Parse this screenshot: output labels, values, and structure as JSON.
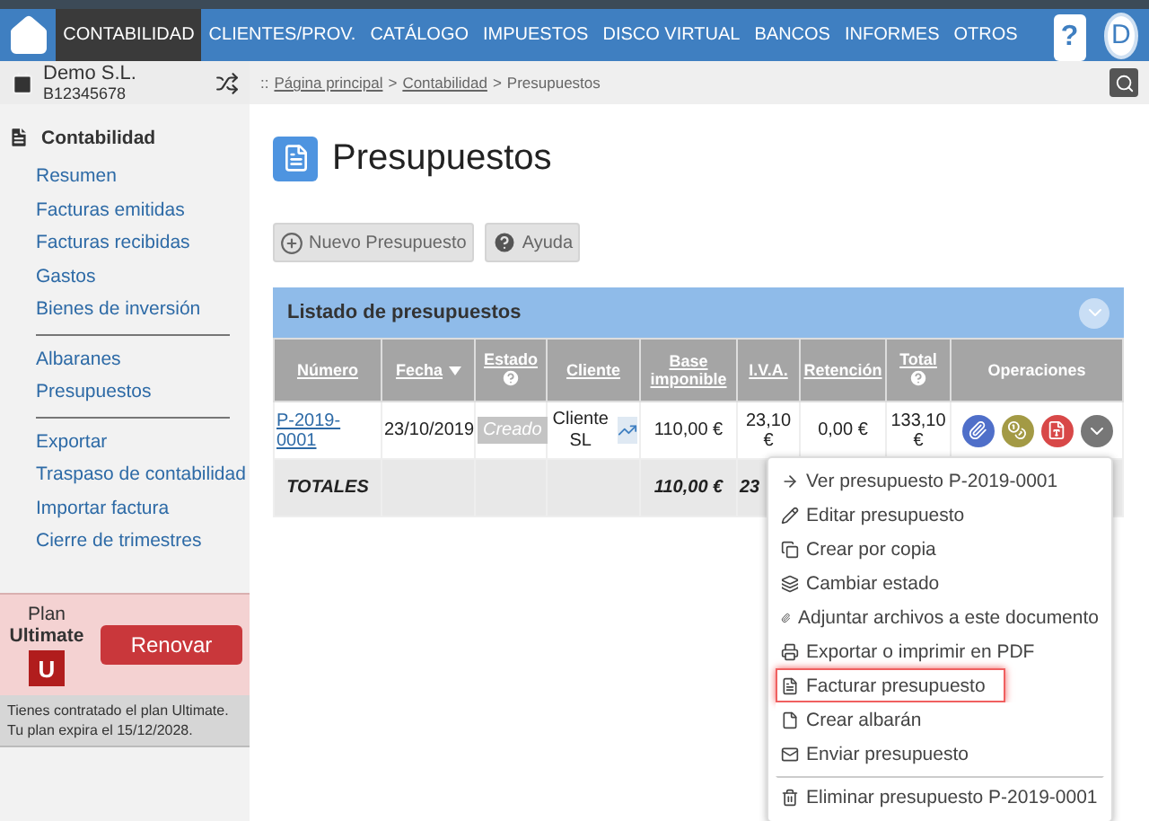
{
  "nav": {
    "items": [
      {
        "label": "CONTABILIDAD",
        "selected": true
      },
      {
        "label": "CLIENTES/PROV.",
        "selected": false
      },
      {
        "label": "CATÁLOGO",
        "selected": false
      },
      {
        "label": "IMPUESTOS",
        "selected": false
      },
      {
        "label": "DISCO VIRTUAL",
        "selected": false
      },
      {
        "label": "BANCOS",
        "selected": false
      },
      {
        "label": "INFORMES",
        "selected": false
      },
      {
        "label": "OTROS",
        "selected": false
      }
    ],
    "help": "?",
    "avatar": "D"
  },
  "company": {
    "name": "Demo S.L.",
    "cif": "B12345678"
  },
  "breadcrumb": {
    "prefix": "::",
    "separator": ">",
    "links": [
      "Página principal",
      "Contabilidad"
    ],
    "current": "Presupuestos"
  },
  "sidebar": {
    "section": "Contabilidad",
    "groups": [
      [
        "Resumen",
        "Facturas emitidas",
        "Facturas recibidas",
        "Gastos",
        "Bienes de inversión"
      ],
      [
        "Albaranes",
        "Presupuestos"
      ],
      [
        "Exportar",
        "Traspaso de contabilidad",
        "Importar factura",
        "Cierre de trimestres"
      ]
    ]
  },
  "plan": {
    "label": "Plan",
    "name": "Ultimate",
    "badge": "U",
    "button": "Renovar",
    "note": "Tienes contratado el plan Ultimate. Tu plan expira el 15/12/2028."
  },
  "page": {
    "title": "Presupuestos",
    "buttons": [
      {
        "label": "Nuevo Presupuesto",
        "kind": "add"
      },
      {
        "label": "Ayuda",
        "kind": "help"
      }
    ]
  },
  "table": {
    "title": "Listado de presupuestos",
    "columns": [
      {
        "label": "Número",
        "link": true,
        "sort": false,
        "help": false
      },
      {
        "label": "Fecha",
        "link": true,
        "sort": true,
        "help": false
      },
      {
        "label": "Estado",
        "link": true,
        "sort": false,
        "help": true
      },
      {
        "label": "Cliente",
        "link": true,
        "sort": false,
        "help": false
      },
      {
        "label": "Base imponible",
        "link": true,
        "sort": false,
        "help": false
      },
      {
        "label": "I.V.A.",
        "link": true,
        "sort": false,
        "help": false
      },
      {
        "label": "Retención",
        "link": true,
        "sort": false,
        "help": false
      },
      {
        "label": "Total",
        "link": true,
        "sort": false,
        "help": true
      },
      {
        "label": "Operaciones",
        "link": false,
        "sort": false,
        "help": false
      }
    ],
    "rows": [
      {
        "numero": "P-2019-0001",
        "fecha": "23/10/2019",
        "estado": "Creado",
        "cliente": "Cliente SL",
        "base": "110,00 €",
        "iva": "23,10 €",
        "retencion": "0,00 €",
        "total": "133,10 €"
      }
    ],
    "totals": {
      "label": "TOTALES",
      "base": "110,00 €",
      "iva": "23"
    }
  },
  "menu": [
    {
      "label": "Ver presupuesto P-2019-0001",
      "kind": "arrow",
      "highlighted": false,
      "divider": false
    },
    {
      "label": "Editar presupuesto",
      "kind": "pencil",
      "highlighted": false,
      "divider": false
    },
    {
      "label": "Crear por copia",
      "kind": "copy",
      "highlighted": false,
      "divider": false
    },
    {
      "label": "Cambiar estado",
      "kind": "stack",
      "highlighted": false,
      "divider": false
    },
    {
      "label": "Adjuntar archivos a este documento",
      "kind": "clip",
      "highlighted": false,
      "divider": false
    },
    {
      "label": "Exportar o imprimir en PDF",
      "kind": "print",
      "highlighted": false,
      "divider": false
    },
    {
      "label": "Facturar presupuesto",
      "kind": "invoice",
      "highlighted": true,
      "divider": false
    },
    {
      "label": "Crear albarán",
      "kind": "note",
      "highlighted": false,
      "divider": false
    },
    {
      "label": "Enviar presupuesto",
      "kind": "mail",
      "highlighted": false,
      "divider": false
    },
    {
      "label": "Eliminar presupuesto P-2019-0001",
      "kind": "trash",
      "highlighted": false,
      "divider": true
    }
  ]
}
